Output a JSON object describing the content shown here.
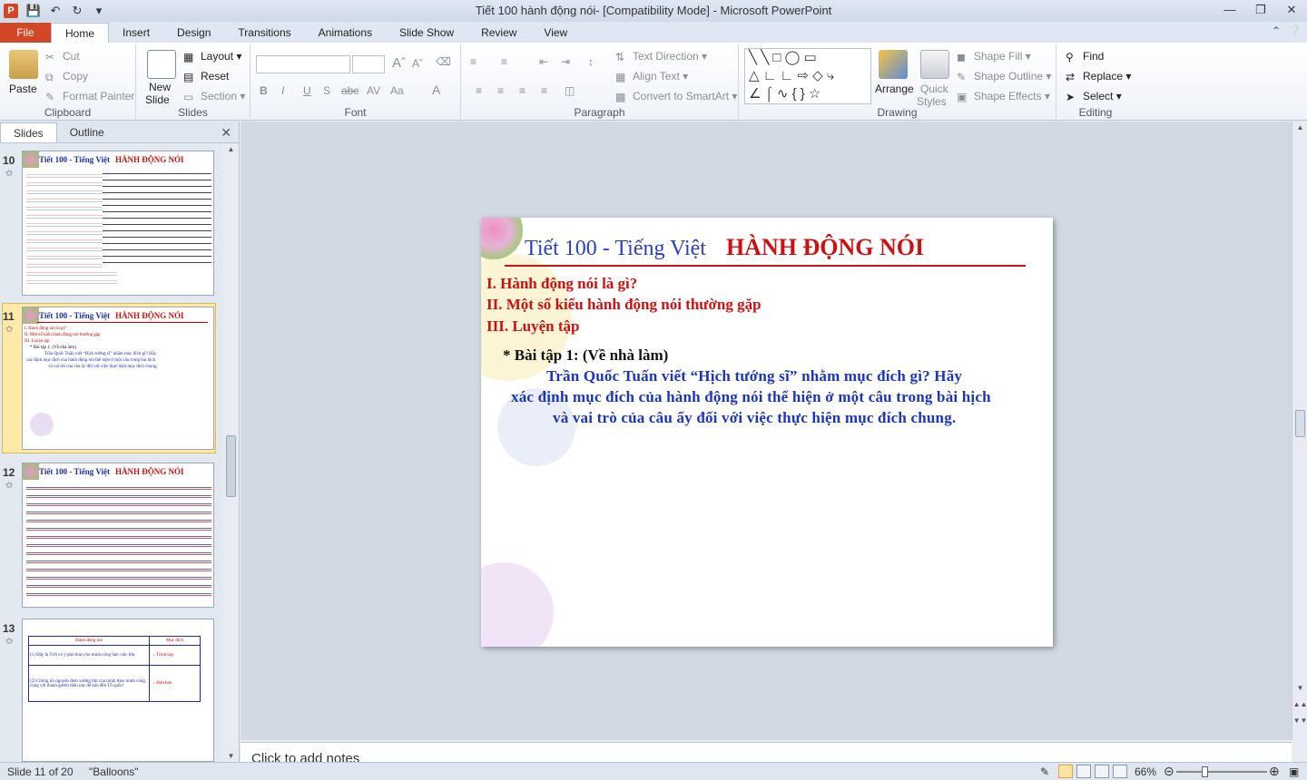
{
  "window": {
    "title": "Tiết 100 hành động nói- [Compatibility Mode]  -  Microsoft PowerPoint",
    "app_icon": "P"
  },
  "ribbon_tabs": [
    "File",
    "Home",
    "Insert",
    "Design",
    "Transitions",
    "Animations",
    "Slide Show",
    "Review",
    "View"
  ],
  "ribbon": {
    "clipboard": {
      "paste": "Paste",
      "cut": "Cut",
      "copy": "Copy",
      "format_painter": "Format Painter",
      "label": "Clipboard"
    },
    "slides": {
      "new_slide_1": "New",
      "new_slide_2": "Slide",
      "layout": "Layout",
      "reset": "Reset",
      "section": "Section",
      "label": "Slides"
    },
    "font": {
      "label": "Font"
    },
    "paragraph": {
      "text_direction": "Text Direction",
      "align_text": "Align Text",
      "convert_smartart": "Convert to SmartArt",
      "label": "Paragraph"
    },
    "drawing": {
      "arrange": "Arrange",
      "quick_styles_1": "Quick",
      "quick_styles_2": "Styles",
      "shape_fill": "Shape Fill",
      "shape_outline": "Shape Outline",
      "shape_effects": "Shape Effects",
      "label": "Drawing"
    },
    "editing": {
      "find": "Find",
      "replace": "Replace",
      "select": "Select",
      "label": "Editing"
    }
  },
  "left_pane": {
    "tab_slides": "Slides",
    "tab_outline": "Outline",
    "thumbs": [
      {
        "num": "10",
        "title": "Tiết 100 - Tiếng Việt",
        "hl": "HÀNH ĐỘNG NÓI"
      },
      {
        "num": "11",
        "title": "Tiết 100 - Tiếng Việt",
        "hl": "HÀNH ĐỘNG NÓI"
      },
      {
        "num": "12",
        "title": "Tiết 100 - Tiếng Việt",
        "hl": "HÀNH ĐỘNG NÓI"
      },
      {
        "num": "13",
        "col1": "Hành động nói",
        "col2": "Mục đích",
        "r1a": "(1) Đây là Trời có ý phó thác cho minh công làm việc lớn.",
        "r1b": "→ Trình bày",
        "r2a": "(2) Chúng tôi nguyện đem xương thịt của mình theo minh công, cùng với thanh gươm thần này để báo đền Tổ quốc!",
        "r2b": "→ Hứa hẹn"
      }
    ]
  },
  "slide": {
    "title_prefix": "Tiết 100 - Tiếng Việt",
    "title_main": "HÀNH ĐỘNG NÓI",
    "items": [
      "I. Hành  động nói là gì?",
      "II. Một số kiểu hành động nói thường gặp",
      "III. Luyện  tập"
    ],
    "task": "* Bài tập 1: (Về nhà làm)",
    "para": [
      "Trần Quốc Tuấn viết “Hịch tướng sĩ” nhằm mục đích gì? Hãy",
      "xác định mục đích của hành động nói thể hiện ở một câu trong bài hịch",
      "và vai trò của câu ấy đối với việc thực hiện mục đích chung."
    ]
  },
  "notes_placeholder": "Click to add notes",
  "status": {
    "slide_of": "Slide 11 of 20",
    "theme": "\"Balloons\"",
    "zoom": "66%"
  },
  "colors": {
    "file_tab": "#d24726",
    "title_blue": "#2a3ec8",
    "title_red": "#d01010",
    "body_blue": "#1a35c0"
  }
}
